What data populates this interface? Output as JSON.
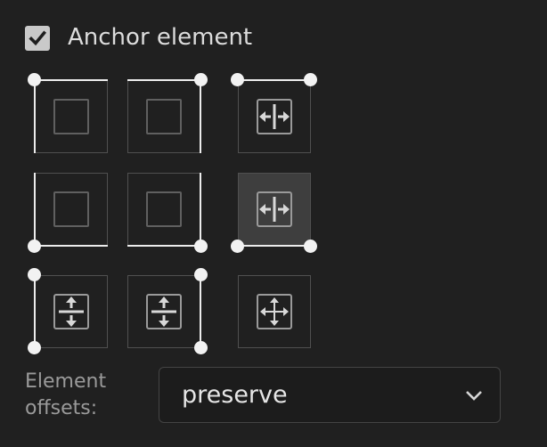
{
  "anchor": {
    "checkbox_label": "Anchor element",
    "checked": true
  },
  "grid": {
    "cells": [
      {
        "id": "top-left",
        "icon": "empty-square-icon",
        "selected": false
      },
      {
        "id": "top-right",
        "icon": "empty-square-icon",
        "selected": false
      },
      {
        "id": "top-stretch",
        "icon": "horizontal-stretch-icon",
        "selected": false
      },
      {
        "id": "bottom-left",
        "icon": "empty-square-icon",
        "selected": false
      },
      {
        "id": "bottom-right",
        "icon": "empty-square-icon",
        "selected": false
      },
      {
        "id": "bottom-stretch",
        "icon": "horizontal-stretch-icon",
        "selected": true
      },
      {
        "id": "left-stretch",
        "icon": "vertical-stretch-icon",
        "selected": false
      },
      {
        "id": "right-stretch",
        "icon": "vertical-stretch-icon",
        "selected": false
      },
      {
        "id": "full-stretch",
        "icon": "move-all-icon",
        "selected": false
      }
    ]
  },
  "offsets": {
    "label_line1": "Element",
    "label_line2": "offsets:",
    "value": "preserve"
  },
  "colors": {
    "background": "#202020",
    "checkbox": "#c9c9c9",
    "selected_cell": "#3e3e3e",
    "anchor_marker": "#f2f2f2"
  }
}
